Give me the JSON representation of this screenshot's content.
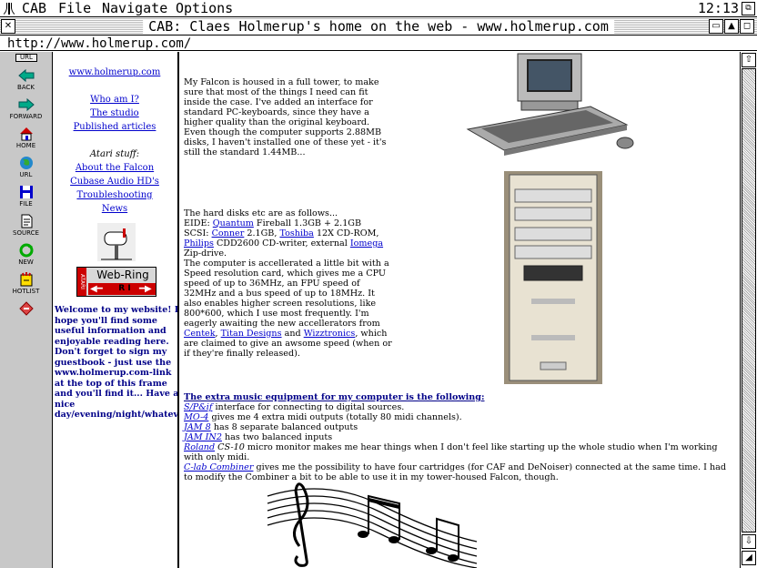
{
  "menubar": {
    "items": [
      "CAB",
      "File",
      "Navigate",
      "Options"
    ],
    "clock": "12:13"
  },
  "window": {
    "title": "CAB: Claes Holmerup's home on the web - www.holmerup.com"
  },
  "urlbar": {
    "url": "http://www.holmerup.com/"
  },
  "toolbar": {
    "url_button": "URL",
    "tools": [
      "BACK",
      "FORWARD",
      "HOME",
      "URL",
      "FILE",
      "SOURCE",
      "NEW",
      "HOTLIST"
    ]
  },
  "left": {
    "site_link": "www.holmerup.com",
    "links": [
      "Who am I?",
      "The studio",
      "Published articles"
    ],
    "atari_heading": "Atari stuff:",
    "atari_links": [
      "About the Falcon",
      "Cubase Audio HD's",
      "Troubleshooting",
      "News"
    ],
    "webring_text": "Web-Ring",
    "webring_side": "ATARI",
    "webring_nav": "R I",
    "welcome": "Welcome to my website! I hope you'll find some useful information and enjoyable reading here. Don't forget to sign my guestbook - just use the www.holmerup.com-link at the top of this frame and you'll find it... Have a nice day/evening/night/whatever..."
  },
  "main": {
    "p1": "My Falcon is housed in a full tower, to make sure that most of the things I need can fit inside the case. I've added an interface for standard PC-keyboards, since they have a higher quality than the original keyboard. Even though the computer supports 2.88MB disks, I haven't installed one of these yet - it's still the standard 1.44MB...",
    "p2_intro": "The hard disks etc are as follows...",
    "eide_label": "EIDE: ",
    "eide_link": "Quantum",
    "eide_rest": " Fireball 1.3GB + 2.1GB",
    "scsi_label": "SCSI: ",
    "scsi_link1": "Conner",
    "scsi_mid1": " 2.1GB, ",
    "scsi_link2": "Toshiba",
    "scsi_mid2": " 12X CD-ROM,",
    "philips_link": "Philips",
    "philips_mid": " CDD2600 CD-writer, external ",
    "iomega_link": "Iomega",
    "zip": "Zip-drive.",
    "p3_a": "The computer is accellerated a little bit with a Speed resolution card, which gives me a CPU speed of up to 36MHz, an FPU speed of 32MHz and a bus speed of up to 18MHz. It also enables higher screen resolutions, like 800*600, which I use most frequently. I'm eagerly awaiting the new accellerators from ",
    "centek_link": "Centek",
    "p3_b": ", ",
    "titan_link": "Titan Designs",
    "p3_c": " and ",
    "wizz_link": "Wizztronics",
    "p3_d": ", which are claimed to give an awsome speed (when or if they're finally released).",
    "music_heading": "The extra music equipment for my computer is the following:",
    "music": [
      {
        "link": "S/P&if",
        "rest": " interface for connecting to digital sources."
      },
      {
        "link": "MO-4",
        "rest": " gives me 4 extra midi outputs (totally 80 midi channels)."
      },
      {
        "link": "JAM 8",
        "rest": " has 8 separate balanced outputs"
      },
      {
        "link": "JAM IN2",
        "rest": " has two balanced inputs"
      },
      {
        "link": "Roland",
        "rest_italic": " CS-10",
        "rest": " micro monitor makes me hear things when I don't feel like starting up the whole studio when I'm working with only midi."
      },
      {
        "link": "C-lab Combiner",
        "rest": " gives me the possibility to have four cartridges (for CAF and DeNoiser) connected at the same time. I had to modify the Combiner a bit to be able to use it in my tower-housed Falcon, though."
      }
    ]
  }
}
